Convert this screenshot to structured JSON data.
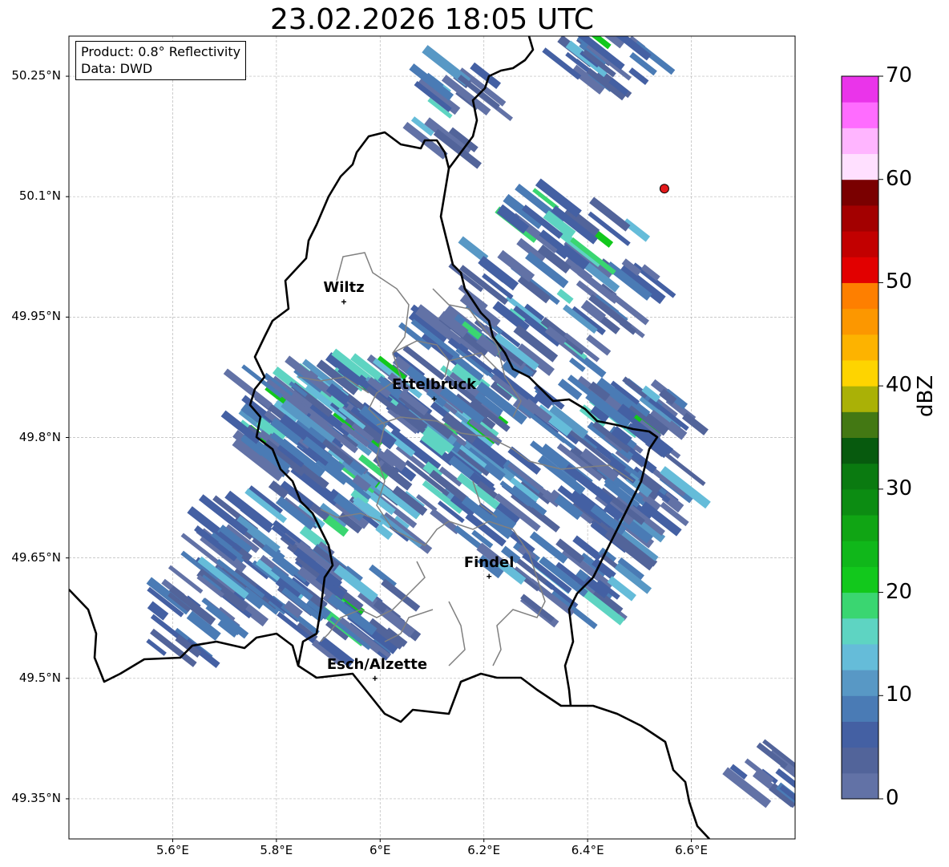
{
  "title": "23.02.2026 18:05 UTC",
  "info": {
    "product": "Product: 0.8° Reflectivity",
    "data": "Data: DWD"
  },
  "map": {
    "lon_range": [
      5.4,
      6.8
    ],
    "lat_range": [
      49.3,
      50.3
    ],
    "lat_ticks": [
      {
        "value": 50.25,
        "label": "50.25°N"
      },
      {
        "value": 50.1,
        "label": "50.1°N"
      },
      {
        "value": 49.95,
        "label": "49.95°N"
      },
      {
        "value": 49.8,
        "label": "49.8°N"
      },
      {
        "value": 49.65,
        "label": "49.65°N"
      },
      {
        "value": 49.5,
        "label": "49.5°N"
      },
      {
        "value": 49.35,
        "label": "49.35°N"
      }
    ],
    "lon_ticks": [
      {
        "value": 5.6,
        "label": "5.6°E"
      },
      {
        "value": 5.8,
        "label": "5.8°E"
      },
      {
        "value": 6.0,
        "label": "6°E"
      },
      {
        "value": 6.2,
        "label": "6.2°E"
      },
      {
        "value": 6.4,
        "label": "6.4°E"
      },
      {
        "value": 6.6,
        "label": "6.6°E"
      }
    ],
    "cities": [
      {
        "name": "Wiltz",
        "lon": 5.93,
        "lat": 49.969
      },
      {
        "name": "Ettelbruck",
        "lon": 6.104,
        "lat": 49.848
      },
      {
        "name": "Findel",
        "lon": 6.21,
        "lat": 49.627
      },
      {
        "name": "Esch/Alzette",
        "lon": 5.99,
        "lat": 49.5
      }
    ],
    "radar_site": {
      "lon": 6.548,
      "lat": 50.11,
      "color": "#e31a1c"
    }
  },
  "colorbar": {
    "label": "dBZ",
    "min": 0,
    "max": 70,
    "ticks": [
      {
        "value": 0,
        "label": "0"
      },
      {
        "value": 10,
        "label": "10"
      },
      {
        "value": 20,
        "label": "20"
      },
      {
        "value": 30,
        "label": "30"
      },
      {
        "value": 40,
        "label": "40"
      },
      {
        "value": 50,
        "label": "50"
      },
      {
        "value": 60,
        "label": "60"
      },
      {
        "value": 70,
        "label": "70"
      }
    ],
    "colors": [
      "#6272a6",
      "#52649a",
      "#4460a3",
      "#4a7bb5",
      "#5898c5",
      "#65bcd9",
      "#5ed4c2",
      "#3ad671",
      "#12c81c",
      "#10b71a",
      "#10a514",
      "#0c8c12",
      "#0a7a10",
      "#075a0e",
      "#437813",
      "#aab106",
      "#fed400",
      "#fdb300",
      "#fc9700",
      "#fe7f00",
      "#e20000",
      "#c20000",
      "#a30000",
      "#7a0000",
      "#ffe0ff",
      "#ffb5ff",
      "#ff6cff",
      "#ea34ea"
    ]
  }
}
